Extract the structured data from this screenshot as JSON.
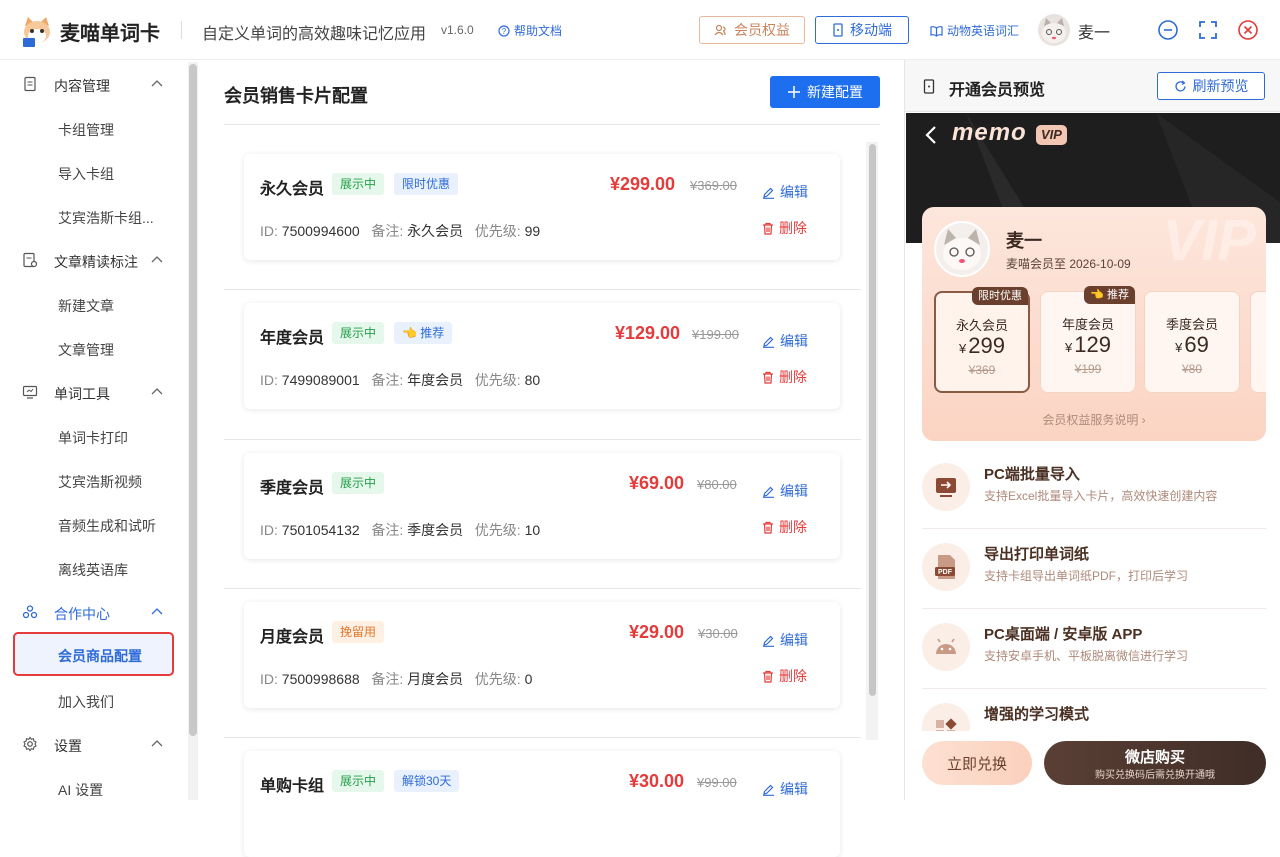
{
  "header": {
    "app_title": "麦喵单词卡",
    "subtitle": "自定义单词的高效趣味记忆应用",
    "version": "v1.6.0",
    "help": "帮助文档",
    "vip_button": "会员权益",
    "mobile_button": "移动端",
    "animal_link": "动物英语词汇",
    "user": "麦一"
  },
  "sidebar": {
    "groups": [
      {
        "label": "内容管理",
        "items": [
          "卡组管理",
          "导入卡组",
          "艾宾浩斯卡组..."
        ]
      },
      {
        "label": "文章精读标注",
        "items": [
          "新建文章",
          "文章管理"
        ]
      },
      {
        "label": "单词工具",
        "items": [
          "单词卡打印",
          "艾宾浩斯视频",
          "音频生成和试听",
          "离线英语库"
        ]
      },
      {
        "label": "合作中心",
        "items": [
          "会员商品配置",
          "加入我们"
        ]
      },
      {
        "label": "设置",
        "items": [
          "AI 设置"
        ]
      }
    ],
    "active_item": "会员商品配置"
  },
  "main": {
    "title": "会员销售卡片配置",
    "new_button": "新建配置",
    "edit_label": "编辑",
    "delete_label": "删除",
    "labels": {
      "id": "ID:",
      "note": "备注:",
      "priority": "优先级:"
    },
    "cards": [
      {
        "name": "永久会员",
        "tags": [
          {
            "text": "展示中",
            "color": "green"
          },
          {
            "text": "限时优惠",
            "color": "blue"
          }
        ],
        "price": "¥299.00",
        "original": "¥369.00",
        "id": "7500994600",
        "note": "永久会员",
        "priority": "99"
      },
      {
        "name": "年度会员",
        "tags": [
          {
            "text": "展示中",
            "color": "green"
          },
          {
            "text": "👈 推荐",
            "color": "blue"
          }
        ],
        "price": "¥129.00",
        "original": "¥199.00",
        "id": "7499089001",
        "note": "年度会员",
        "priority": "80"
      },
      {
        "name": "季度会员",
        "tags": [
          {
            "text": "展示中",
            "color": "green"
          }
        ],
        "price": "¥69.00",
        "original": "¥80.00",
        "id": "7501054132",
        "note": "季度会员",
        "priority": "10"
      },
      {
        "name": "月度会员",
        "tags": [
          {
            "text": "挽留用",
            "color": "orange"
          }
        ],
        "price": "¥29.00",
        "original": "¥30.00",
        "id": "7500998688",
        "note": "月度会员",
        "priority": "0"
      },
      {
        "name": "单购卡组",
        "tags": [
          {
            "text": "展示中",
            "color": "green"
          },
          {
            "text": "解锁30天",
            "color": "blue"
          }
        ],
        "price": "¥30.00",
        "original": "¥99.00",
        "id": "",
        "note": "",
        "priority": ""
      }
    ]
  },
  "preview": {
    "title": "开通会员预览",
    "refresh_button": "刷新预览",
    "brand": "memo",
    "brand_badge": "VIP",
    "watermark": "VIP",
    "user_name": "麦一",
    "expire_text": "麦喵会员至 2026-10-09",
    "plans": [
      {
        "name": "永久会员",
        "currency": "¥",
        "price": "299",
        "original": "¥369",
        "ribbon": "限时优惠",
        "selected": true
      },
      {
        "name": "年度会员",
        "currency": "¥",
        "price": "129",
        "original": "¥199",
        "ribbon": "👈 推荐",
        "selected": false
      },
      {
        "name": "季度会员",
        "currency": "¥",
        "price": "69",
        "original": "¥80",
        "ribbon": "",
        "selected": false
      }
    ],
    "benefits_link": "会员权益服务说明 ›",
    "features": [
      {
        "title": "PC端批量导入",
        "desc": "支持Excel批量导入卡片，高效快速创建内容",
        "icon": "import-icon"
      },
      {
        "title": "导出打印单词纸",
        "desc": "支持卡组导出单词纸PDF，打印后学习",
        "icon": "pdf-icon"
      },
      {
        "title": "PC桌面端 / 安卓版 APP",
        "desc": "支持安卓手机、平板脱离微信进行学习",
        "icon": "android-icon"
      },
      {
        "title": "增强的学习模式",
        "desc": "",
        "icon": "mode-icon"
      }
    ],
    "redeem_button": "立即兑换",
    "buy_button": "微店购买",
    "buy_sub": "购买兑换码后需兑换开通哦"
  },
  "colors": {
    "primary": "#1e6ff0",
    "danger": "#e53b3b",
    "vip_brown": "#6b3f2d"
  }
}
